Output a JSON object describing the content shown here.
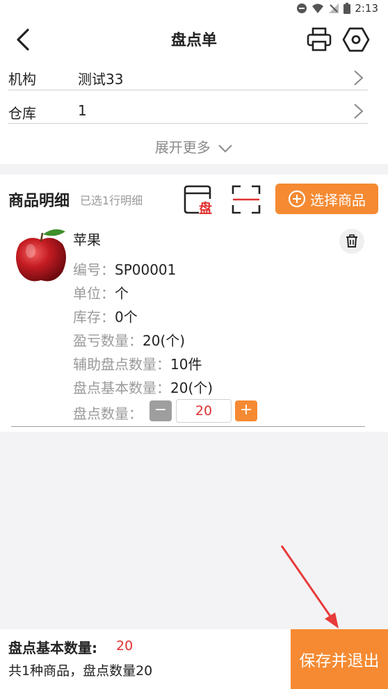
{
  "status": {
    "time": "2:13"
  },
  "nav": {
    "title": "盘点单"
  },
  "form": {
    "rows": [
      {
        "label": "机构",
        "value": "测试33"
      },
      {
        "label": "仓库",
        "value": "1"
      }
    ],
    "expand_label": "展开更多"
  },
  "details": {
    "title": "商品明细",
    "subtitle": "已选1行明细",
    "select_button": "选择商品",
    "pan_badge": "盘"
  },
  "product": {
    "name": "苹果",
    "attrs": [
      {
        "key": "编号：",
        "value": "SP00001"
      },
      {
        "key": "单位：",
        "value": "个"
      },
      {
        "key": "库存：",
        "value": "0个"
      },
      {
        "key": "盈亏数量：",
        "value": "20(个)"
      },
      {
        "key": "辅助盘点数量：",
        "value": "10件"
      },
      {
        "key": "盘点基本数量：",
        "value": "20(个)"
      }
    ],
    "qty_label": "盘点数量：",
    "qty_value": "20",
    "minus": "−",
    "plus": "+"
  },
  "footer": {
    "base_label": "盘点基本数量:",
    "base_value": "20",
    "summary": "共1种商品，盘点数量20",
    "save_button": "保存并退出"
  },
  "colors": {
    "accent": "#f58a32",
    "danger": "#e03030"
  }
}
